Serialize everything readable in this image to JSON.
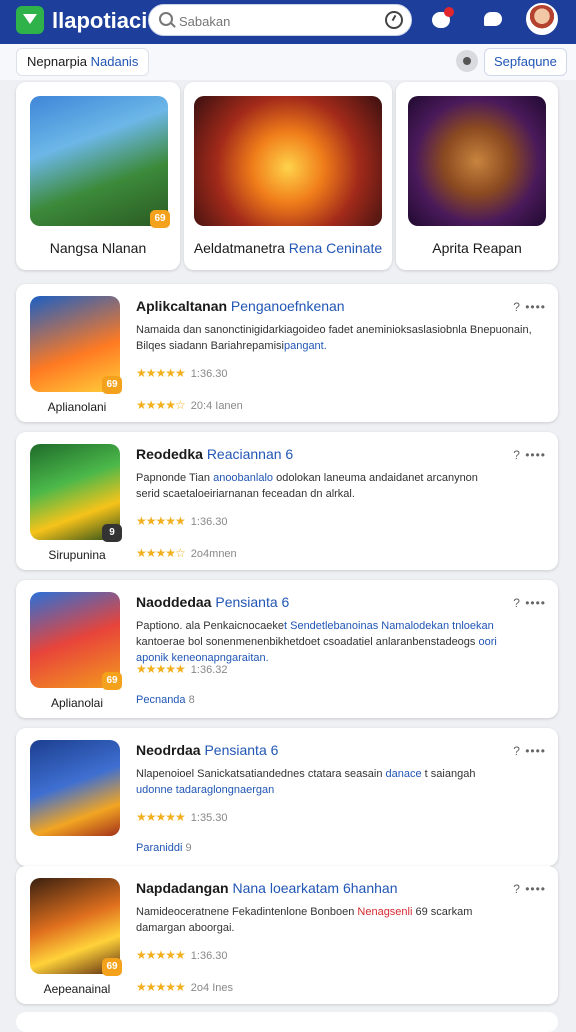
{
  "header": {
    "app_title": "llapotiaci",
    "search_placeholder": "Sabakan",
    "logo_icon": "play-store-logo",
    "icons": [
      "search-icon",
      "history-icon",
      "notification-icon",
      "chat-icon",
      "avatar"
    ]
  },
  "filter": {
    "chip_label_1": "Nepnarpia",
    "chip_label_2": "Nadanis",
    "sort_label": "Sepfaqune"
  },
  "featured": [
    {
      "name": "Nangsa Nlanan"
    },
    {
      "name_1": "Aeldatmanetra",
      "name_2": "Rena Ceninate"
    },
    {
      "name": "Aprita Reapan"
    }
  ],
  "apps": [
    {
      "title": "Aplikcaltanan",
      "title_blue": "Penganoefnkenan",
      "more": "? ••••",
      "desc_1": "Namaida dan sanonctinigidarkiagoideo fadet aneminioksaslasiobnla Bnepuonain,",
      "desc_2": "Bilqes siadann Bariahrepamisi",
      "desc_2_blue": "pangant.",
      "rating_1": "1:36.30",
      "rating_2": "20:4 Ianen",
      "category": "Aplianolani",
      "badge": "69"
    },
    {
      "title": "Reodedka",
      "title_blue": "Reaciannan 6",
      "more": "? ••••",
      "desc_1": "Papnonde Tian",
      "desc_1_blue": "anoobanlalo",
      "desc_1b": "odolokan laneuma andaidanet arcanynon",
      "desc_2": "serid scaetaloeiriarnanan feceadan dn alrkal.",
      "rating_1": "1:36.30",
      "rating_2": "2o4mnen",
      "category": "Sirupunina",
      "badge": "9"
    },
    {
      "title": "Naoddedaa",
      "title_blue": "Pensianta 6",
      "more": "? ••••",
      "desc_1": "Paptiono. ala Penkaicnocaeke",
      "desc_1_blue": "t Sendetlebanoinas Namalodekan tnloekan",
      "desc_2": "kantoerae bol sonenmenenbikhetdoet csoadatiel anlaranbenstadeogs",
      "desc_2_blue": "oori",
      "desc_3_blue": "aponik keneonapngaraitan.",
      "rating_1": "1:36.32",
      "rating_2_blue": "Pecnanda",
      "rating_2": "8",
      "category": "Aplianolai",
      "badge": "69"
    },
    {
      "title": "Neodrdaa",
      "title_blue": "Pensianta 6",
      "more": "? ••••",
      "desc_1": "Nlapenoioel Sanickatsatiandednes ctatara seasain",
      "desc_1_blue": "danace",
      "desc_1b": "t saiangah",
      "desc_2_blue": "udonne tadaraglongnaergan",
      "rating_1": "1:35.30",
      "rating_2_blue": "Paraniddi",
      "rating_2": "9",
      "category": "",
      "badge": ""
    },
    {
      "title": "Napdadangan",
      "title_blue": "Nana loearkatam 6hanhan",
      "more": "? ••••",
      "desc_1": "Namideoceratnene Fekadintenlone Bonboen",
      "desc_1_red": "Nenagsenli",
      "desc_1b": "69 scarkam",
      "desc_2": "damargan aboorgai.",
      "rating_1": "1:36.30",
      "rating_2": "2o4 Ines",
      "category": "Aepeanainal",
      "badge": "69"
    }
  ],
  "colors": {
    "header_bg": "#1d3f9b",
    "accent_blue": "#2156b5",
    "star": "#f2b01e",
    "badge": "#f4a11c"
  }
}
